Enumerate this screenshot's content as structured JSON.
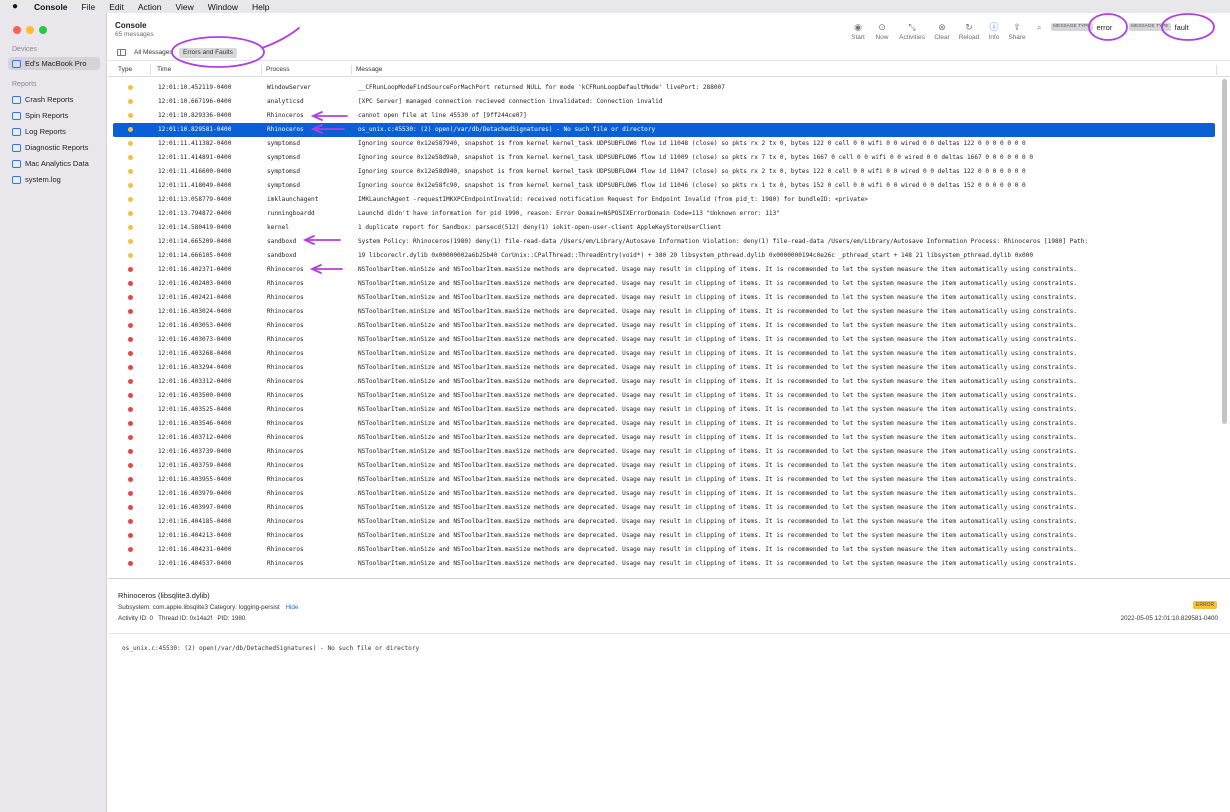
{
  "menubar": {
    "app": "Console",
    "items": [
      "File",
      "Edit",
      "Action",
      "View",
      "Window",
      "Help"
    ]
  },
  "sidebar": {
    "devices_header": "Devices",
    "device": "Ed's MacBook Pro",
    "reports_header": "Reports",
    "reports": [
      "Crash Reports",
      "Spin Reports",
      "Log Reports",
      "Diagnostic Reports",
      "Mac Analytics Data",
      "system.log"
    ]
  },
  "toolbar": {
    "title": "Console",
    "subtitle": "65 messages",
    "buttons": [
      "Start",
      "Now",
      "Activities",
      "Clear",
      "Reload",
      "Info",
      "Share"
    ],
    "tokens": [
      {
        "type": "MESSAGE TYPE",
        "value": "error"
      },
      {
        "type": "MESSAGE TYPE",
        "value": "fault"
      }
    ]
  },
  "filters": {
    "all": "All Messages",
    "errors": "Errors and Faults"
  },
  "table": {
    "columns": [
      "Type",
      "Time",
      "Process",
      "Message"
    ],
    "rows": [
      {
        "type": "error",
        "time": "12:01:10.452119-0400",
        "process": "WindowServer",
        "message": "__CFRunLoopModeFindSourceForMachPort returned NULL for mode 'kCFRunLoopDefaultMode' livePort: 288007"
      },
      {
        "type": "error",
        "time": "12:01:10.667196-0400",
        "process": "analyticsd",
        "message": "[XPC Server] managed connection recieved connection invalidated: Connection invalid"
      },
      {
        "type": "error",
        "time": "12:01:10.829336-0400",
        "process": "Rhinoceros",
        "message": "cannot open file at line 45530 of [9ff244ce07]"
      },
      {
        "type": "error",
        "time": "12:01:10.829581-0400",
        "process": "Rhinoceros",
        "message": "os_unix.c:45530: (2) open(/var/db/DetachedSignatures) - No such file or directory",
        "selected": true
      },
      {
        "type": "error",
        "time": "12:01:11.411382-0400",
        "process": "symptomsd",
        "message": "Ignoring source 0x12e587940, snapshot is from kernel kernel_task UDPSUBFLOW6 flow id 11048 (close) so pkts rx 2 tx 0, bytes 122 0 cell 0 0 wifi 0 0 wired 0 0 deltas 122 0 0 0 0 0 0 0"
      },
      {
        "type": "error",
        "time": "12:01:11.414891-0400",
        "process": "symptomsd",
        "message": "Ignoring source 0x12e58d9a0, snapshot is from kernel kernel_task UDPSUBFLOW6 flow id 11009 (close) so pkts rx 7 tx 0, bytes 1667 0 cell 0 0 wifi 0 0 wired 0 0 deltas 1667 0 0 0 0 0 0 0"
      },
      {
        "type": "error",
        "time": "12:01:11.416600-0400",
        "process": "symptomsd",
        "message": "Ignoring source 0x12e58d940, snapshot is from kernel kernel_task UDPSUBFLOW4 flow id 11047 (close) so pkts rx 2 tx 0, bytes 122 0 cell 0 0 wifi 0 0 wired 0 0 deltas 122 0 0 0 0 0 0 0"
      },
      {
        "type": "error",
        "time": "12:01:11.418049-0400",
        "process": "symptomsd",
        "message": "Ignoring source 0x12e58fc90, snapshot is from kernel kernel_task UDPSUBFLOW6 flow id 11046 (close) so pkts rx 1 tx 0, bytes 152 0 cell 0 0 wifi 0 0 wired 0 0 deltas 152 0 0 0 0 0 0 0"
      },
      {
        "type": "error",
        "time": "12:01:13.058779-0400",
        "process": "imklaunchagent",
        "message": "IMKLaunchAgent -requestIMKXPCEndpointInvalid: received notification Request for Endpoint Invalid (from pid_t: 1980) for bundleID: <private>"
      },
      {
        "type": "error",
        "time": "12:01:13.794872-0400",
        "process": "runningboardd",
        "message": "Launchd didn't have information for pid 1990, reason: Error Domain=NSPOSIXErrorDomain Code=113 \"Unknown error: 113\""
      },
      {
        "type": "error",
        "time": "12:01:14.580419-0400",
        "process": "kernel",
        "message": "1 duplicate report for Sandbox: parsecd(512) deny(1) iokit-open-user-client AppleKeyStoreUserClient"
      },
      {
        "type": "error",
        "time": "12:01:14.665209-0400",
        "process": "sandboxd",
        "message": "System Policy: Rhinoceros(1980) deny(1) file-read-data /Users/em/Library/Autosave Information Violation:       deny(1) file-read-data /Users/em/Library/Autosave Information Process:         Rhinoceros [1980] Path:"
      },
      {
        "type": "error",
        "time": "12:01:14.666105-0400",
        "process": "sandboxd",
        "message": "19  libcoreclr.dylib                0x00000002a6b25b40 CorUnix::CPalThread::ThreadEntry(void*) + 380 20  libsystem_pthread.dylib       0x0000000194c0e26c _pthread_start + 148 21  libsystem_pthread.dylib       0x000"
      },
      {
        "type": "fault",
        "time": "12:01:16.402371-0400",
        "process": "Rhinoceros",
        "message": "NSToolbarItem.minSize and NSToolbarItem.maxSize methods are deprecated. Usage may result in clipping of items. It is recommended to let the system measure the item automatically using constraints."
      },
      {
        "type": "fault",
        "time": "12:01:16.402403-0400",
        "process": "Rhinoceros",
        "message": "NSToolbarItem.minSize and NSToolbarItem.maxSize methods are deprecated. Usage may result in clipping of items. It is recommended to let the system measure the item automatically using constraints."
      },
      {
        "type": "fault",
        "time": "12:01:16.402421-0400",
        "process": "Rhinoceros",
        "message": "NSToolbarItem.minSize and NSToolbarItem.maxSize methods are deprecated. Usage may result in clipping of items. It is recommended to let the system measure the item automatically using constraints."
      },
      {
        "type": "fault",
        "time": "12:01:16.403024-0400",
        "process": "Rhinoceros",
        "message": "NSToolbarItem.minSize and NSToolbarItem.maxSize methods are deprecated. Usage may result in clipping of items. It is recommended to let the system measure the item automatically using constraints."
      },
      {
        "type": "fault",
        "time": "12:01:16.403053-0400",
        "process": "Rhinoceros",
        "message": "NSToolbarItem.minSize and NSToolbarItem.maxSize methods are deprecated. Usage may result in clipping of items. It is recommended to let the system measure the item automatically using constraints."
      },
      {
        "type": "fault",
        "time": "12:01:16.403073-0400",
        "process": "Rhinoceros",
        "message": "NSToolbarItem.minSize and NSToolbarItem.maxSize methods are deprecated. Usage may result in clipping of items. It is recommended to let the system measure the item automatically using constraints."
      },
      {
        "type": "fault",
        "time": "12:01:16.403268-0400",
        "process": "Rhinoceros",
        "message": "NSToolbarItem.minSize and NSToolbarItem.maxSize methods are deprecated. Usage may result in clipping of items. It is recommended to let the system measure the item automatically using constraints."
      },
      {
        "type": "fault",
        "time": "12:01:16.403294-0400",
        "process": "Rhinoceros",
        "message": "NSToolbarItem.minSize and NSToolbarItem.maxSize methods are deprecated. Usage may result in clipping of items. It is recommended to let the system measure the item automatically using constraints."
      },
      {
        "type": "fault",
        "time": "12:01:16.403312-0400",
        "process": "Rhinoceros",
        "message": "NSToolbarItem.minSize and NSToolbarItem.maxSize methods are deprecated. Usage may result in clipping of items. It is recommended to let the system measure the item automatically using constraints."
      },
      {
        "type": "fault",
        "time": "12:01:16.403500-0400",
        "process": "Rhinoceros",
        "message": "NSToolbarItem.minSize and NSToolbarItem.maxSize methods are deprecated. Usage may result in clipping of items. It is recommended to let the system measure the item automatically using constraints."
      },
      {
        "type": "fault",
        "time": "12:01:16.403525-0400",
        "process": "Rhinoceros",
        "message": "NSToolbarItem.minSize and NSToolbarItem.maxSize methods are deprecated. Usage may result in clipping of items. It is recommended to let the system measure the item automatically using constraints."
      },
      {
        "type": "fault",
        "time": "12:01:16.403546-0400",
        "process": "Rhinoceros",
        "message": "NSToolbarItem.minSize and NSToolbarItem.maxSize methods are deprecated. Usage may result in clipping of items. It is recommended to let the system measure the item automatically using constraints."
      },
      {
        "type": "fault",
        "time": "12:01:16.403712-0400",
        "process": "Rhinoceros",
        "message": "NSToolbarItem.minSize and NSToolbarItem.maxSize methods are deprecated. Usage may result in clipping of items. It is recommended to let the system measure the item automatically using constraints."
      },
      {
        "type": "fault",
        "time": "12:01:16.403739-0400",
        "process": "Rhinoceros",
        "message": "NSToolbarItem.minSize and NSToolbarItem.maxSize methods are deprecated. Usage may result in clipping of items. It is recommended to let the system measure the item automatically using constraints."
      },
      {
        "type": "fault",
        "time": "12:01:16.403759-0400",
        "process": "Rhinoceros",
        "message": "NSToolbarItem.minSize and NSToolbarItem.maxSize methods are deprecated. Usage may result in clipping of items. It is recommended to let the system measure the item automatically using constraints."
      },
      {
        "type": "fault",
        "time": "12:01:16.403955-0400",
        "process": "Rhinoceros",
        "message": "NSToolbarItem.minSize and NSToolbarItem.maxSize methods are deprecated. Usage may result in clipping of items. It is recommended to let the system measure the item automatically using constraints."
      },
      {
        "type": "fault",
        "time": "12:01:16.403979-0400",
        "process": "Rhinoceros",
        "message": "NSToolbarItem.minSize and NSToolbarItem.maxSize methods are deprecated. Usage may result in clipping of items. It is recommended to let the system measure the item automatically using constraints."
      },
      {
        "type": "fault",
        "time": "12:01:16.403997-0400",
        "process": "Rhinoceros",
        "message": "NSToolbarItem.minSize and NSToolbarItem.maxSize methods are deprecated. Usage may result in clipping of items. It is recommended to let the system measure the item automatically using constraints."
      },
      {
        "type": "fault",
        "time": "12:01:16.404185-0400",
        "process": "Rhinoceros",
        "message": "NSToolbarItem.minSize and NSToolbarItem.maxSize methods are deprecated. Usage may result in clipping of items. It is recommended to let the system measure the item automatically using constraints."
      },
      {
        "type": "fault",
        "time": "12:01:16.404213-0400",
        "process": "Rhinoceros",
        "message": "NSToolbarItem.minSize and NSToolbarItem.maxSize methods are deprecated. Usage may result in clipping of items. It is recommended to let the system measure the item automatically using constraints."
      },
      {
        "type": "fault",
        "time": "12:01:16.404231-0400",
        "process": "Rhinoceros",
        "message": "NSToolbarItem.minSize and NSToolbarItem.maxSize methods are deprecated. Usage may result in clipping of items. It is recommended to let the system measure the item automatically using constraints."
      },
      {
        "type": "fault",
        "time": "12:01:16.404537-0400",
        "process": "Rhinoceros",
        "message": "NSToolbarItem.minSize and NSToolbarItem.maxSize methods are deprecated. Usage may result in clipping of items. It is recommended to let the system measure the item automatically using constraints."
      }
    ]
  },
  "detail": {
    "title": "Rhinoceros (libsqlite3.dylib)",
    "subsystem_label": "Subsystem:",
    "subsystem": "com.apple.libsqlite3",
    "category_label": "Category:",
    "category": "logging-persist",
    "hide": "Hide",
    "activity_label": "Activity ID:",
    "activity": "0",
    "thread_label": "Thread ID:",
    "thread": "0x14a2f",
    "pid_label": "PID:",
    "pid": "1980",
    "badge": "ERROR",
    "date": "2022-05-05 12:01:10.829581-0400",
    "message": "os_unix.c:45530: (2) open(/var/db/DetachedSignatures) - No such file or directory"
  },
  "colors": {
    "accent": "#0a5fd7",
    "error_dot": "#f0c049",
    "fault_dot": "#e4474a",
    "annotation": "#b33fe0"
  }
}
